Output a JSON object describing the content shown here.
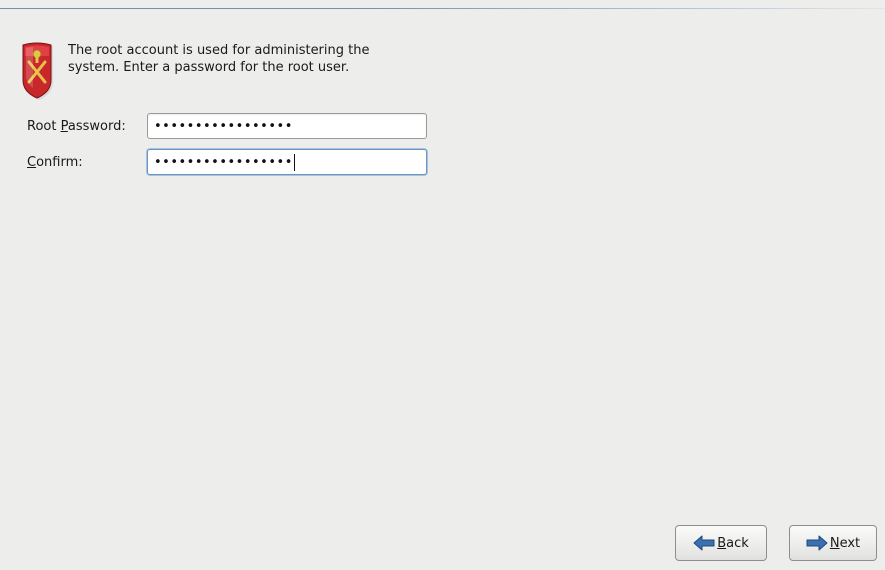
{
  "header": {
    "description": "The root account is used for administering the system.  Enter a password for the root user.",
    "icon": "shield-icon"
  },
  "form": {
    "root_password": {
      "label_prefix": "Root ",
      "label_mnemonic": "P",
      "label_suffix": "assword:",
      "value_masked": "•••••••••••••••••"
    },
    "confirm": {
      "label_mnemonic": "C",
      "label_suffix": "onfirm:",
      "value_masked": "•••••••••••••••••"
    }
  },
  "buttons": {
    "back": {
      "mnemonic": "B",
      "rest": "ack",
      "icon": "arrow-left-icon"
    },
    "next": {
      "mnemonic": "N",
      "rest": "ext",
      "icon": "arrow-right-icon"
    }
  },
  "colors": {
    "background": "#ededeb",
    "arrow_blue": "#3a6fb0",
    "shield_red": "#c8272b",
    "shield_gold": "#e7c24a"
  }
}
